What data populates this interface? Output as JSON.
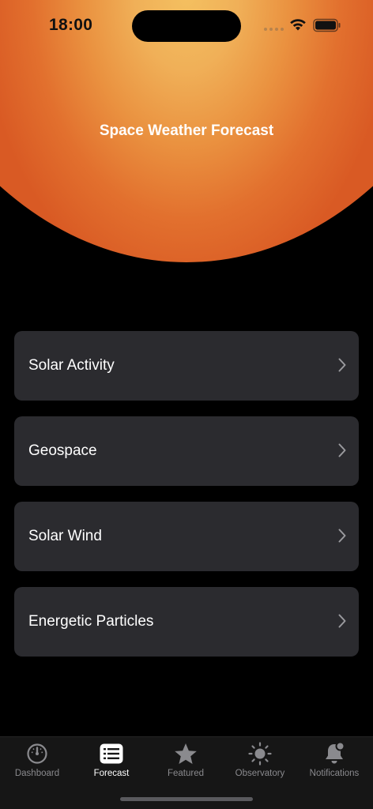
{
  "status_bar": {
    "time": "18:00"
  },
  "header": {
    "title": "Space Weather Forecast"
  },
  "menu": {
    "items": [
      {
        "label": "Solar Activity"
      },
      {
        "label": "Geospace"
      },
      {
        "label": "Solar Wind"
      },
      {
        "label": "Energetic Particles"
      }
    ]
  },
  "tabbar": {
    "tabs": [
      {
        "label": "Dashboard",
        "icon": "gauge-icon",
        "active": false
      },
      {
        "label": "Forecast",
        "icon": "list-icon",
        "active": true
      },
      {
        "label": "Featured",
        "icon": "star-icon",
        "active": false
      },
      {
        "label": "Observatory",
        "icon": "sun-icon",
        "active": false
      },
      {
        "label": "Notifications",
        "icon": "bell-icon",
        "active": false
      }
    ]
  },
  "colors": {
    "sun_top": "#f4c060",
    "sun_bottom": "#d95a24",
    "card": "#2b2b2f",
    "tab_inactive": "#8a8a8e"
  }
}
